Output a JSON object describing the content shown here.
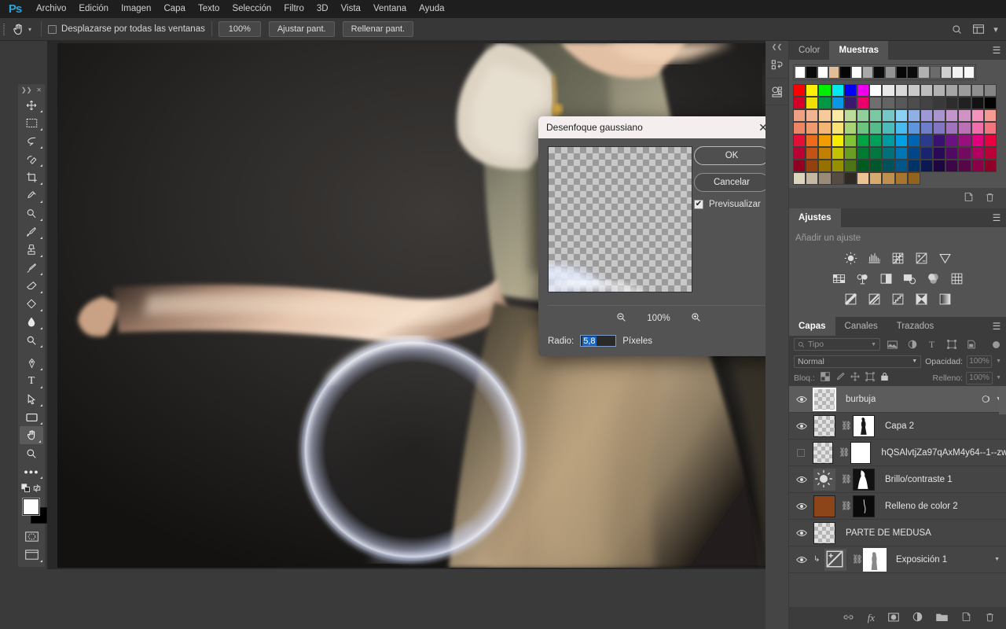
{
  "app": {
    "logo": "Ps"
  },
  "menubar": {
    "items": [
      "Archivo",
      "Edición",
      "Imagen",
      "Capa",
      "Texto",
      "Selección",
      "Filtro",
      "3D",
      "Vista",
      "Ventana",
      "Ayuda"
    ]
  },
  "optionsbar": {
    "tool_icon": "hand-icon",
    "checkbox_label": "Desplazarse por todas las ventanas",
    "checkbox_checked": false,
    "buttons": [
      "100%",
      "Ajustar pant.",
      "Rellenar pant."
    ],
    "right_icons": [
      "search-icon",
      "workspace-icon",
      "chevron-down-icon"
    ]
  },
  "toolbar": {
    "tools": [
      {
        "name": "move-tool",
        "glyph": "✥"
      },
      {
        "name": "marquee-tool",
        "glyph": "▭"
      },
      {
        "name": "lasso-tool",
        "glyph": "◄"
      },
      {
        "name": "quick-selection-tool",
        "glyph": "◌"
      },
      {
        "name": "crop-tool",
        "glyph": "⌗"
      },
      {
        "name": "eyedropper-tool",
        "glyph": "✎"
      },
      {
        "name": "healing-brush-tool",
        "glyph": "◉"
      },
      {
        "name": "brush-tool",
        "glyph": "✏"
      },
      {
        "name": "clone-stamp-tool",
        "glyph": "⎙"
      },
      {
        "name": "history-brush-tool",
        "glyph": "✒"
      },
      {
        "name": "eraser-tool",
        "glyph": "◣"
      },
      {
        "name": "gradient-tool",
        "glyph": "▧"
      },
      {
        "name": "blur-tool",
        "glyph": "◍"
      },
      {
        "name": "dodge-tool",
        "glyph": "◐"
      },
      {
        "name": "pen-tool",
        "glyph": "✒"
      },
      {
        "name": "type-tool",
        "glyph": "T"
      },
      {
        "name": "path-selection-tool",
        "glyph": "➤"
      },
      {
        "name": "rectangle-tool",
        "glyph": "▢"
      },
      {
        "name": "hand-tool",
        "glyph": "✋",
        "active": true
      },
      {
        "name": "zoom-tool",
        "glyph": "🔍"
      },
      {
        "name": "more-tools",
        "glyph": "•••"
      }
    ],
    "foreground_color": "#ffffff",
    "background_color": "#000000"
  },
  "dialog": {
    "title": "Desenfoque gaussiano",
    "close_label": "✕",
    "ok_label": "OK",
    "cancel_label": "Cancelar",
    "preview_label": "Previsualizar",
    "preview_checked": true,
    "zoom_value": "100%",
    "radius_label": "Radio:",
    "radius_value": "5,8",
    "radius_units": "Píxeles"
  },
  "color_panel": {
    "tabs": [
      "Color",
      "Muestras"
    ],
    "active_tab": "Muestras",
    "recent_swatches": [
      "#ffffff",
      "#0a0a0a",
      "#fdfdfd",
      "#e3bd96",
      "#050505",
      "#fbfbfb",
      "#a8a8a8",
      "#0c0c0c",
      "#939393",
      "#070707",
      "#0b0b0b",
      "#b0b0b0",
      "#6b6b6b",
      "#cfcfcf",
      "#f2f2f2",
      "#f8f8f8"
    ],
    "swatch_rows": [
      [
        "#ff0000",
        "#fff000",
        "#00ee00",
        "#00e8f0",
        "#0000f6",
        "#ee00ee",
        "#ffffff",
        "#e8e8e8",
        "#d8d8d8",
        "#c9c9c9",
        "#bdbdbd",
        "#b2b2b2",
        "#a5a5a5",
        "#9b9b9b",
        "#8f8f8f",
        "#858585"
      ],
      [
        "#d50026",
        "#efe000",
        "#019744",
        "#0b95e5",
        "#3a186e",
        "#e90068",
        "#6f6f6f",
        "#646464",
        "#585858",
        "#4d4d4d",
        "#434343",
        "#393939",
        "#2d2d2d",
        "#212121",
        "#121212",
        "#030303"
      ],
      [
        "#f0a184",
        "#f2b391",
        "#f5cb9a",
        "#faeaa4",
        "#bddc9a",
        "#92cf9a",
        "#7bc8a4",
        "#76c8c6",
        "#8ad2f3",
        "#8fb0e4",
        "#9d98d6",
        "#ab95cf",
        "#c295cb",
        "#d094c4",
        "#f494bc",
        "#f59a93"
      ],
      [
        "#ee8665",
        "#f09a6d",
        "#f4b673",
        "#f8e176",
        "#a8d477",
        "#6cc57e",
        "#55bd8c",
        "#4cbcbb",
        "#49bcef",
        "#5f95de",
        "#6f7ecb",
        "#8275c4",
        "#a073bf",
        "#bb70b7",
        "#ef6faa",
        "#f0757f"
      ],
      [
        "#e40e37",
        "#ee6b1a",
        "#f19c00",
        "#f6ec00",
        "#7ec435",
        "#00a443",
        "#00a05b",
        "#009ba1",
        "#00a0e4",
        "#0064b3",
        "#2a3b8f",
        "#3a1173",
        "#6c1181",
        "#96117e",
        "#e3007f",
        "#e8003f"
      ],
      [
        "#bb0033",
        "#c35315",
        "#c38000",
        "#c3c200",
        "#6a9e22",
        "#007c31",
        "#00783f",
        "#00707a",
        "#0076b5",
        "#00478a",
        "#17256e",
        "#2a0a57",
        "#510a63",
        "#730a5f",
        "#b40060",
        "#bb0037"
      ],
      [
        "#8f0023",
        "#96400d",
        "#967100",
        "#968f00",
        "#4d7516",
        "#005b1f",
        "#00572c",
        "#005159",
        "#00568a",
        "#003367",
        "#0b1851",
        "#1e0640",
        "#3d0649",
        "#570647",
        "#8c0048",
        "#8f0028"
      ],
      [
        "#ddd6be",
        "#c6b9a4",
        "#9a8b79",
        "#574c43",
        "#2f2823",
        "#edc491",
        "#d6a96c",
        "#bf8f4e",
        "#a8752f",
        "#93621d"
      ]
    ],
    "footer_icons": [
      "new-swatch-icon",
      "delete-swatch-icon"
    ]
  },
  "adjustments_panel": {
    "title": "Ajustes",
    "hint": "Añadir un ajuste",
    "icons_row1": [
      "brightness-contrast-icon",
      "levels-icon",
      "curves-icon",
      "exposure-icon",
      "vibrance-icon"
    ],
    "icons_row2": [
      "hue-saturation-icon",
      "color-balance-icon",
      "black-white-icon",
      "photo-filter-icon",
      "channel-mixer-icon",
      "color-lookup-icon"
    ],
    "icons_row3": [
      "invert-icon",
      "posterize-icon",
      "threshold-icon",
      "selective-color-icon",
      "gradient-map-icon"
    ]
  },
  "layers_panel": {
    "tabs": [
      "Capas",
      "Canales",
      "Trazados"
    ],
    "active_tab": "Capas",
    "filter_placeholder": "Tipo",
    "filter_icons": [
      "pixel-filter-icon",
      "adjustment-filter-icon",
      "type-filter-icon",
      "shape-filter-icon",
      "smartobject-filter-icon"
    ],
    "blend_mode": "Normal",
    "opacity_label": "Opacidad:",
    "opacity_value": "100%",
    "lock_label": "Bloq.:",
    "lock_icons": [
      "lock-transparency-icon",
      "lock-image-icon",
      "lock-position-icon",
      "lock-artboard-icon",
      "lock-all-icon"
    ],
    "fill_label": "Relleno:",
    "fill_value": "100%",
    "layers": [
      {
        "name": "burbuja",
        "visible": true,
        "selected": true,
        "thumb": "checker",
        "has_link": false,
        "has_mask": false,
        "fx": true
      },
      {
        "name": "Capa 2",
        "visible": true,
        "selected": false,
        "thumb": "checker",
        "has_link": true,
        "has_mask": true
      },
      {
        "name": "hQSAlvtjZa97qAxM4y64--1--zw...",
        "visible": false,
        "selected": false,
        "thumb": "checker",
        "has_link": true,
        "has_mask": true
      },
      {
        "name": "Brillo/contraste 1",
        "visible": true,
        "selected": false,
        "thumb": "adjustment",
        "has_link": true,
        "has_mask": true
      },
      {
        "name": "Relleno de color 2",
        "visible": true,
        "selected": false,
        "thumb": "solidfill",
        "thumb_color": "#8b4518",
        "has_link": true,
        "has_mask": true
      },
      {
        "name": "PARTE DE MEDUSA",
        "visible": true,
        "selected": false,
        "thumb": "checker",
        "has_link": false,
        "has_mask": false
      },
      {
        "name": "Exposición 1",
        "visible": true,
        "selected": false,
        "thumb": "adjustment",
        "has_link": true,
        "has_mask": true,
        "clipped": true
      }
    ],
    "footer_icons": [
      "link-layers-icon",
      "fx-icon",
      "add-mask-icon",
      "new-adjustment-icon",
      "new-group-icon",
      "new-layer-icon",
      "delete-layer-icon"
    ]
  }
}
